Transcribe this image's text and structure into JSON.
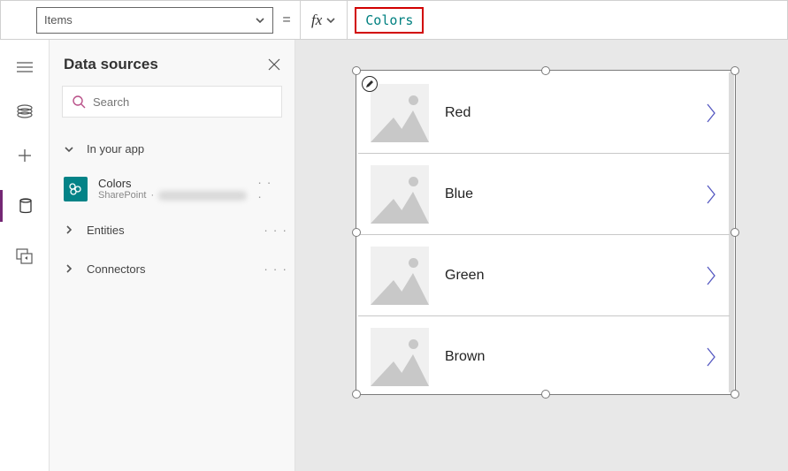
{
  "topbar": {
    "property_label": "Items",
    "equals": "=",
    "formula_value": "Colors"
  },
  "panel": {
    "title": "Data sources",
    "search_placeholder": "Search",
    "sections": {
      "in_app": "In your app",
      "entities": "Entities",
      "connectors": "Connectors"
    },
    "data_source": {
      "name": "Colors",
      "provider": "SharePoint"
    }
  },
  "gallery": {
    "items": [
      {
        "title": "Red"
      },
      {
        "title": "Blue"
      },
      {
        "title": "Green"
      },
      {
        "title": "Brown"
      }
    ]
  },
  "colors": {
    "accent": "#742774",
    "teal_icon": "#038387",
    "chevron": "#5558c1",
    "highlight_box": "#d10000"
  }
}
